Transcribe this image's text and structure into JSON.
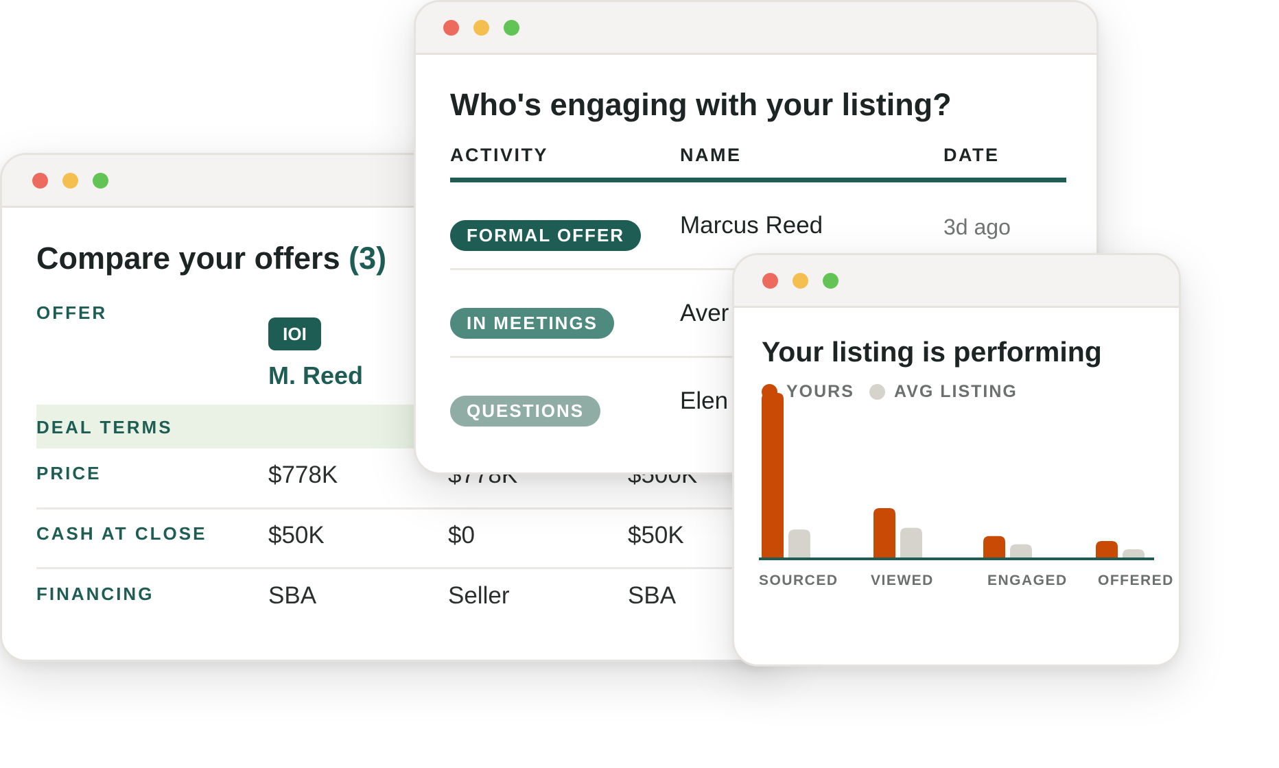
{
  "offers_window": {
    "title": "Compare your offers",
    "count": "(3)",
    "offer_label": "OFFER",
    "first_offer": {
      "badge": "IOI",
      "name": "M. Reed"
    },
    "deal_terms_label": "DEAL TERMS",
    "rows": [
      {
        "label": "PRICE",
        "values": [
          "$778K",
          "$778K",
          "$500K"
        ]
      },
      {
        "label": "CASH AT CLOSE",
        "values": [
          "$50K",
          "$0",
          "$50K"
        ]
      },
      {
        "label": "FINANCING",
        "values": [
          "SBA",
          "Seller",
          "SBA"
        ]
      }
    ]
  },
  "engage_window": {
    "title": "Who's engaging with your listing?",
    "columns": [
      "ACTIVITY",
      "NAME",
      "DATE"
    ],
    "rows": [
      {
        "activity": "FORMAL OFFER",
        "color": "#1e5d53",
        "name": "Marcus Reed",
        "date": "3d ago"
      },
      {
        "activity": "IN MEETINGS",
        "color": "#4f8a7f",
        "name": "Aver",
        "date": ""
      },
      {
        "activity": "QUESTIONS",
        "color": "#8fada4",
        "name": "Elen",
        "date": ""
      }
    ]
  },
  "perf_window": {
    "title": "Your listing is performing",
    "legend": [
      {
        "label": "YOURS",
        "color": "#c94a05"
      },
      {
        "label": "AVG LISTING",
        "color": "#d6d2cc"
      }
    ]
  },
  "chart_data": {
    "type": "bar",
    "title": "Your listing is performing",
    "categories": [
      "SOURCED",
      "VIEWED",
      "ENGAGED",
      "OFFERED"
    ],
    "series": [
      {
        "name": "YOURS",
        "color": "#c94a05",
        "values": [
          100,
          30,
          13,
          10
        ]
      },
      {
        "name": "AVG LISTING",
        "color": "#d6d2cc",
        "values": [
          17,
          18,
          8,
          5
        ]
      }
    ],
    "ylim": [
      0,
      100
    ],
    "grid": false,
    "legend": "top-left"
  }
}
